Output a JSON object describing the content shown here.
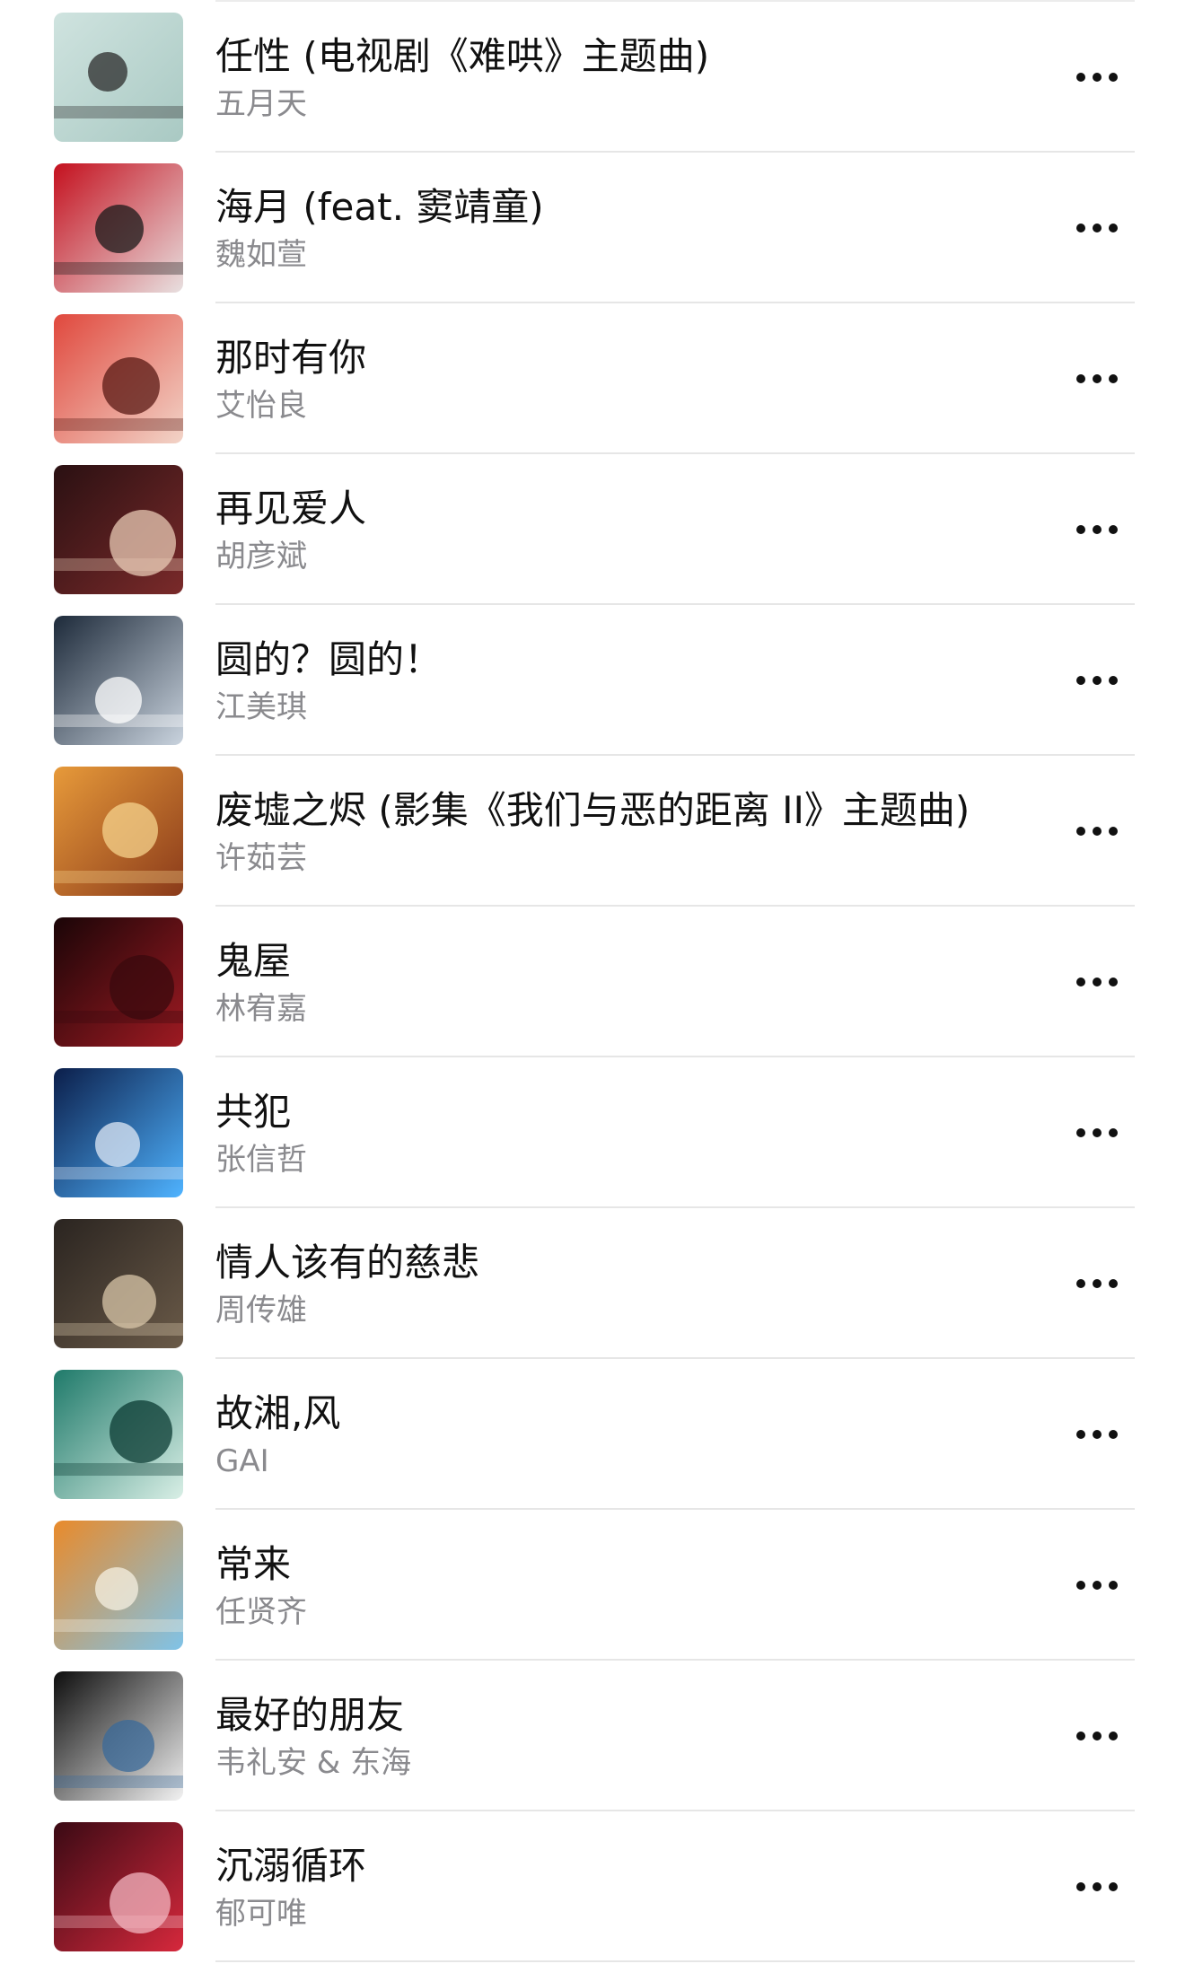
{
  "songs": [
    {
      "title": "任性 (电视剧《难哄》主题曲)",
      "artist": "五月天",
      "cover_icon": "album-cover-band",
      "cover_colors": [
        "#cfe3df",
        "#a9c9c3",
        "#2b2b2b"
      ]
    },
    {
      "title": "海月 (feat. 窦靖童)",
      "artist": "魏如萱",
      "cover_icon": "album-cover-jellyfish",
      "cover_colors": [
        "#c4101e",
        "#e8e0e0",
        "#1a1a1a"
      ]
    },
    {
      "title": "那时有你",
      "artist": "艾怡良",
      "cover_icon": "album-cover-figure",
      "cover_colors": [
        "#e0483d",
        "#f2d4c8",
        "#5a1a14"
      ]
    },
    {
      "title": "再见爱人",
      "artist": "胡彦斌",
      "cover_icon": "album-cover-portraits",
      "cover_colors": [
        "#2a1012",
        "#7a2a2a",
        "#e8c9b4"
      ]
    },
    {
      "title": "圆的？圆的！",
      "artist": "江美琪",
      "cover_icon": "album-cover-circles",
      "cover_colors": [
        "#1d2a3a",
        "#c9d3de",
        "#ffffff"
      ]
    },
    {
      "title": "废墟之烬 (影集《我们与恶的距离 II》主题曲)",
      "artist": "许茹芸",
      "cover_icon": "album-cover-drama",
      "cover_colors": [
        "#e79a3a",
        "#8a3a1a",
        "#f6d38c"
      ]
    },
    {
      "title": "鬼屋",
      "artist": "林宥嘉",
      "cover_icon": "album-cover-ghost",
      "cover_colors": [
        "#1a0507",
        "#9e1a22",
        "#3a0a0d"
      ]
    },
    {
      "title": "共犯",
      "artist": "张信哲",
      "cover_icon": "album-cover-profile",
      "cover_colors": [
        "#0b1e4a",
        "#4fb3ff",
        "#dfe8f5"
      ]
    },
    {
      "title": "情人该有的慈悲",
      "artist": "周传雄",
      "cover_icon": "album-cover-piano",
      "cover_colors": [
        "#2a2420",
        "#6a5a48",
        "#d8c6a8"
      ]
    },
    {
      "title": "故湘,风",
      "artist": "GAI",
      "cover_icon": "album-cover-landscape",
      "cover_colors": [
        "#1f7a6a",
        "#d9efe6",
        "#0b3b33"
      ]
    },
    {
      "title": "常来",
      "artist": "任贤齐",
      "cover_icon": "album-cover-sky",
      "cover_colors": [
        "#e98a2a",
        "#7fc3e8",
        "#f6f0e2"
      ]
    },
    {
      "title": "最好的朋友",
      "artist": "韦礼安 & 东海",
      "cover_icon": "album-cover-polaroid",
      "cover_colors": [
        "#0d0d0d",
        "#f2f2f2",
        "#3a6a9a"
      ]
    },
    {
      "title": "沉溺循环",
      "artist": "郁可唯",
      "cover_icon": "album-cover-neon",
      "cover_colors": [
        "#3a0a14",
        "#d6283c",
        "#f3b6c0"
      ]
    }
  ],
  "more_icon": "ellipsis-icon",
  "more_color": "#111111"
}
